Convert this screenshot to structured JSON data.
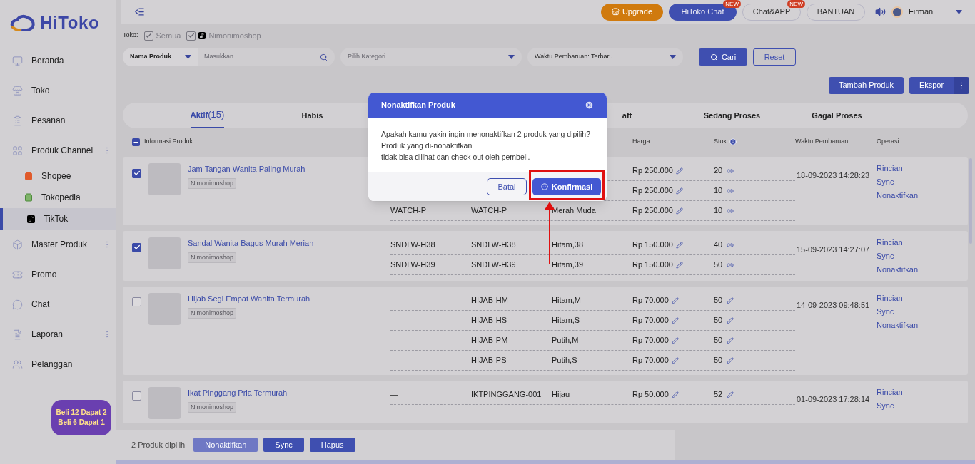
{
  "brand": "HiToko",
  "header": {
    "buttons": [
      {
        "label": "Upgrade",
        "kind": "upgrade"
      },
      {
        "label": "HiToko Chat",
        "kind": "primary",
        "badge": "NEW"
      },
      {
        "label": "Chat&APP",
        "kind": "outline",
        "badge": "NEW"
      },
      {
        "label": "BANTUAN",
        "kind": "outline"
      }
    ],
    "user": "Firman"
  },
  "sidebar": {
    "items": [
      {
        "label": "Beranda",
        "more": false
      },
      {
        "label": "Toko",
        "more": false
      },
      {
        "label": "Pesanan",
        "more": false
      },
      {
        "label": "Produk Channel",
        "more": true,
        "children": [
          {
            "label": "Shopee",
            "selected": false
          },
          {
            "label": "Tokopedia",
            "selected": false
          },
          {
            "label": "TikTok",
            "selected": true
          }
        ]
      },
      {
        "label": "Master Produk",
        "more": true
      },
      {
        "label": "Promo",
        "more": false
      },
      {
        "label": "Chat",
        "more": false
      },
      {
        "label": "Laporan",
        "more": true
      },
      {
        "label": "Pelanggan",
        "more": false
      }
    ],
    "promo_badge": [
      "Beli 12 Dapat 2",
      "Beli 6 Dapat 1"
    ]
  },
  "filters": {
    "store_label": "Toko:",
    "stores": [
      {
        "label": "Semua",
        "checked": true
      },
      {
        "label": "Nimonimoshop",
        "checked": true
      }
    ],
    "search_type": "Nama Produk",
    "search_placeholder": "Masukkan",
    "category_placeholder": "Pilih Kategori",
    "sort": "Waktu Pembaruan: Terbaru",
    "search_button": "Cari",
    "reset_button": "Reset"
  },
  "actions": [
    "Tambah Produk",
    "Ekspor"
  ],
  "tabs": [
    {
      "label": "Aktif",
      "count": "(15)",
      "selected": true
    },
    {
      "label": "Habis",
      "selected": false
    },
    {
      "label": "aft",
      "selected": false
    },
    {
      "label": "Sedang Proses",
      "selected": false
    },
    {
      "label": "Gagal Proses",
      "selected": false
    }
  ],
  "table": {
    "select_all": {
      "indeterminate": true
    },
    "columns": [
      {
        "label": "Informasi Produk"
      },
      {
        "label": "Harga"
      },
      {
        "label": "Stok",
        "info": true
      },
      {
        "label": "Waktu Pembaruan"
      },
      {
        "label": "Operasi"
      }
    ],
    "rows": [
      {
        "name": "Jam Tangan Wanita Paling Murah",
        "store": "Nimonimoshop",
        "selected": true,
        "updated": "18-09-2023 14:28:23",
        "operations": [
          "Rincian",
          "Sync",
          "Nonaktifkan"
        ],
        "stock_linked": true,
        "variants": [
          {
            "price": "Rp 250.000",
            "stock": "20"
          },
          {
            "price": "Rp 250.000",
            "stock": "10"
          },
          {
            "column_2": "WATCH-P",
            "column_3": "WATCH-P",
            "column_4": "Merah Muda",
            "price": "Rp 250.000",
            "stock": "10"
          }
        ]
      },
      {
        "name": "Sandal Wanita Bagus Murah Meriah",
        "store": "Nimonimoshop",
        "selected": true,
        "updated": "15-09-2023 14:27:07",
        "operations": [
          "Rincian",
          "Sync",
          "Nonaktifkan"
        ],
        "stock_linked": true,
        "variants": [
          {
            "column_2": "SNDLW-H38",
            "column_3": "SNDLW-H38",
            "column_4": "Hitam,38",
            "price": "Rp 150.000",
            "stock": "40"
          },
          {
            "column_2": "SNDLW-H39",
            "column_3": "SNDLW-H39",
            "column_4": "Hitam,39",
            "price": "Rp 150.000",
            "stock": "50"
          }
        ]
      },
      {
        "name": "Hijab Segi Empat Wanita Termurah",
        "store": "Nimonimoshop",
        "selected": false,
        "updated": "14-09-2023 09:48:51",
        "operations": [
          "Rincian",
          "Sync",
          "Nonaktifkan"
        ],
        "stock_linked": false,
        "variants": [
          {
            "column_2": "—",
            "column_3": "HIJAB-HM",
            "column_4": "Hitam,M",
            "price": "Rp 70.000",
            "stock": "50"
          },
          {
            "column_2": "—",
            "column_3": "HIJAB-HS",
            "column_4": "Hitam,S",
            "price": "Rp 70.000",
            "stock": "50"
          },
          {
            "column_2": "—",
            "column_3": "HIJAB-PM",
            "column_4": "Putih,M",
            "price": "Rp 70.000",
            "stock": "50"
          },
          {
            "column_2": "—",
            "column_3": "HIJAB-PS",
            "column_4": "Putih,S",
            "price": "Rp 70.000",
            "stock": "50"
          }
        ]
      },
      {
        "name": "Ikat Pinggang Pria Termurah",
        "store": "Nimonimoshop",
        "selected": false,
        "updated": "01-09-2023 17:28:14",
        "operations": [
          "Rincian",
          "Sync"
        ],
        "stock_linked": false,
        "variants": [
          {
            "column_2": "—",
            "column_3": "IKTPINGGANG-001",
            "column_4": "Hijau",
            "price": "Rp 50.000",
            "stock": "52"
          }
        ]
      }
    ]
  },
  "footer": {
    "selected_count": "2 Produk dipilih",
    "buttons": [
      {
        "label": "Nonaktifkan",
        "kind": "light"
      },
      {
        "label": "Sync",
        "kind": "primary"
      },
      {
        "label": "Hapus",
        "kind": "primary"
      }
    ]
  },
  "dialog": {
    "title": "Nonaktifkan Produk",
    "lines": [
      "Apakah kamu yakin ingin menonaktifkan 2 produk yang dipilih?",
      "Produk yang di-nonaktifkan",
      "tidak bisa dilihat dan check out oleh pembeli."
    ],
    "cancel": "Batal",
    "confirm": "Konfirmasi",
    "confirm_highlighted": true
  }
}
